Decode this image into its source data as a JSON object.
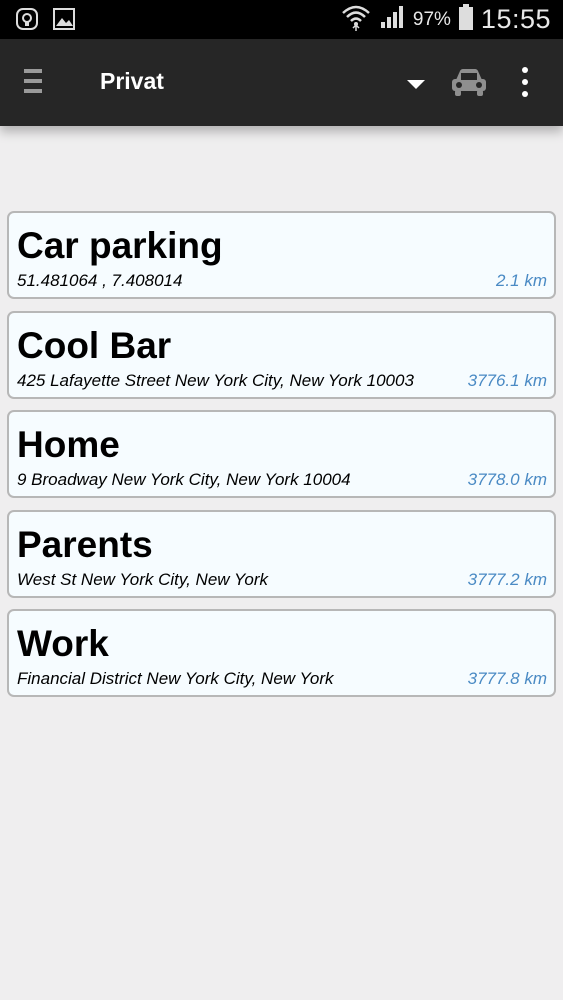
{
  "status_bar": {
    "battery_text": "97%",
    "time": "15:55",
    "icons": [
      "shield-notification-icon",
      "image-notification-icon",
      "wifi-icon",
      "signal-icon",
      "battery-icon"
    ]
  },
  "app_bar": {
    "title": "Privat",
    "icons": [
      "menu-icon",
      "dropdown-arrow-icon",
      "car-icon",
      "overflow-menu-icon"
    ]
  },
  "locations": [
    {
      "name": "Car parking",
      "address": "51.481064 , 7.408014",
      "distance": "2.1 km"
    },
    {
      "name": "Cool Bar",
      "address": "425 Lafayette Street New York City, New York 10003",
      "distance": "3776.1 km"
    },
    {
      "name": "Home",
      "address": "9 Broadway New York City, New York 10004",
      "distance": "3778.0 km"
    },
    {
      "name": "Parents",
      "address": "West St New York City, New York",
      "distance": "3777.2 km"
    },
    {
      "name": "Work",
      "address": "Financial District New York City, New York",
      "distance": "3777.8 km"
    }
  ],
  "colors": {
    "app_bar": "#262626",
    "status_bar": "#000000",
    "background": "#efeeef",
    "card_background": "#f6fcff",
    "card_border": "#b7b7b7",
    "distance_text": "#4a8ac4"
  }
}
